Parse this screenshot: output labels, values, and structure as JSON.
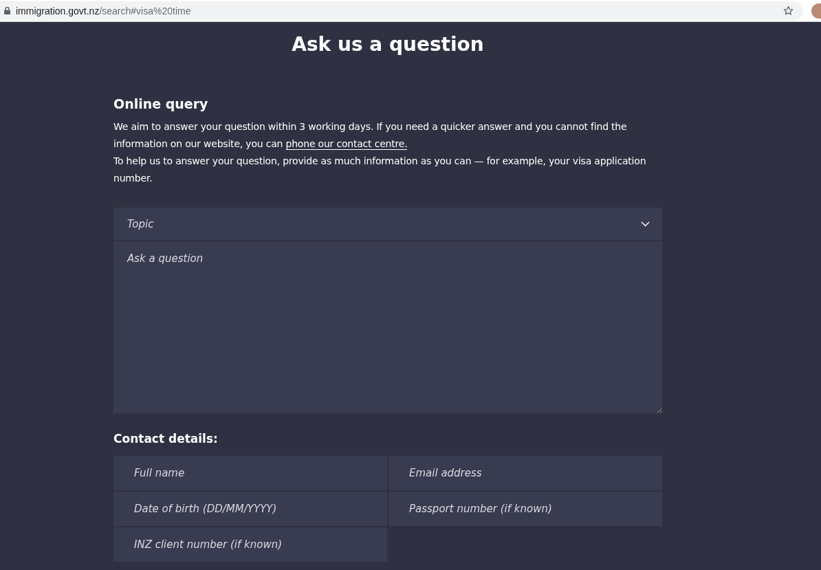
{
  "browser": {
    "url_host": "immigration.govt.nz",
    "url_path": "/search#visa%20time"
  },
  "page": {
    "title": "Ask us a question"
  },
  "query": {
    "heading": "Online query",
    "paragraphs": [
      {
        "text": "We aim to answer your question within 3 working days. If you need a quicker answer and you cannot find the information on our website, you can ",
        "link": "phone our contact centre."
      },
      {
        "text": "To help us to answer your question, provide as much information as you can — for example, your visa application number."
      }
    ],
    "topic": {
      "placeholder": "Topic"
    },
    "question": {
      "placeholder": "Ask a question"
    }
  },
  "contact": {
    "heading": "Contact details:",
    "fields": [
      {
        "placeholder": "Full name"
      },
      {
        "placeholder": "Email address"
      },
      {
        "placeholder": "Date of birth (DD/MM/YYYY)"
      },
      {
        "placeholder": "Passport number (if known)"
      },
      {
        "placeholder": "INZ client number (if known)"
      }
    ]
  }
}
